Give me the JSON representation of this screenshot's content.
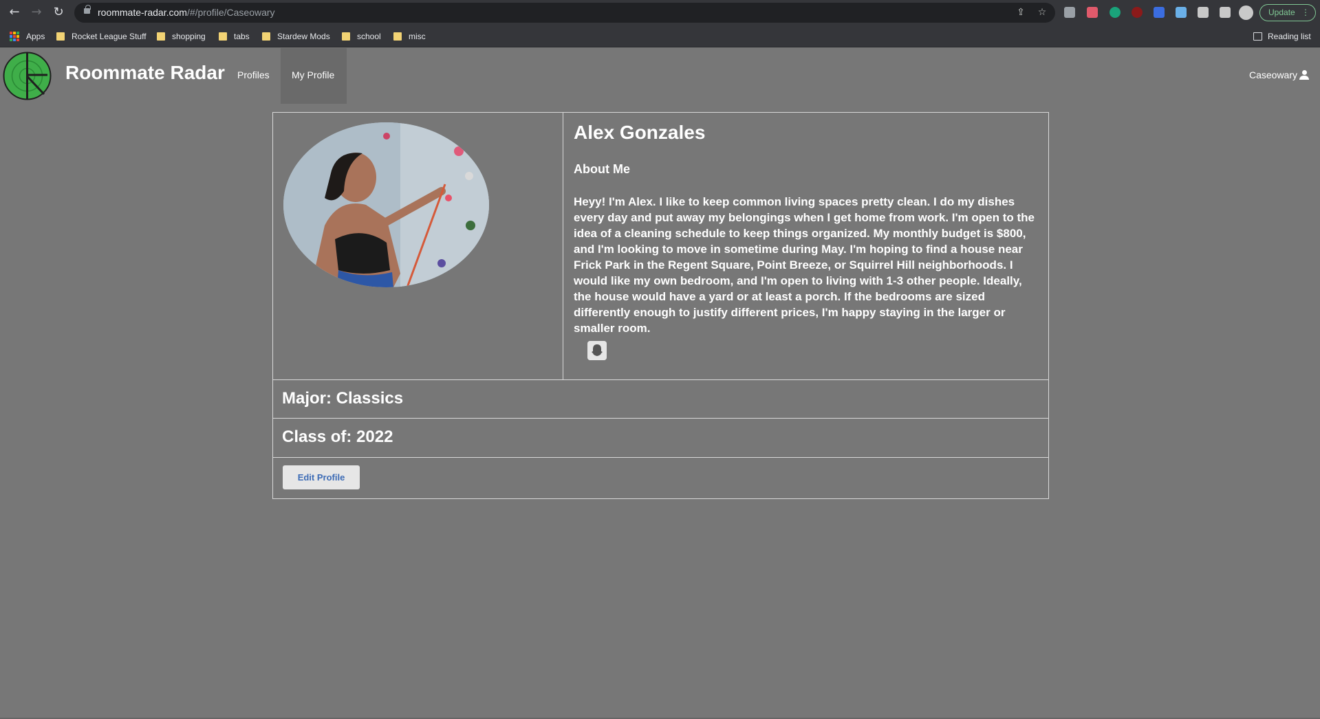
{
  "browser": {
    "url_host": "roommate-radar.com",
    "url_path": "/#/profile/Caseowary",
    "update_label": "Update",
    "bookmarks": [
      "Apps",
      "Rocket League Stuff",
      "shopping",
      "tabs",
      "Stardew Mods",
      "school",
      "misc"
    ],
    "reading_list": "Reading list"
  },
  "navbar": {
    "title": "Roommate Radar",
    "links": [
      "Profiles",
      "My Profile"
    ],
    "active_link": "My Profile",
    "username": "Caseowary"
  },
  "profile": {
    "name": "Alex Gonzales",
    "about_heading": "About Me",
    "about_text": "Heyy! I'm Alex. I like to keep common living spaces pretty clean. I do my dishes every day and put away my belongings when I get home from work. I'm open to the idea of a cleaning schedule to keep things organized. My monthly budget is $800, and I'm looking to move in sometime during May. I'm hoping to find a house near Frick Park in the Regent Square, Point Breeze, or Squirrel Hill neighborhoods. I would like my own bedroom, and I'm open to living with 1-3 other people. Ideally, the house would have a yard or at least a porch. If the bedrooms are sized differently enough to justify different prices, I'm happy staying in the larger or smaller room.",
    "major": "Major: Classics",
    "class_of": "Class of: 2022",
    "edit_button": "Edit Profile"
  },
  "icons": {
    "social": "snapchat-icon",
    "user": "user-icon",
    "logo": "radar-logo"
  },
  "colors": {
    "page_background": "#777777",
    "card_border": "#d9d9d9",
    "button_text": "#3c6bb5",
    "logo_green": "#3fae49"
  }
}
